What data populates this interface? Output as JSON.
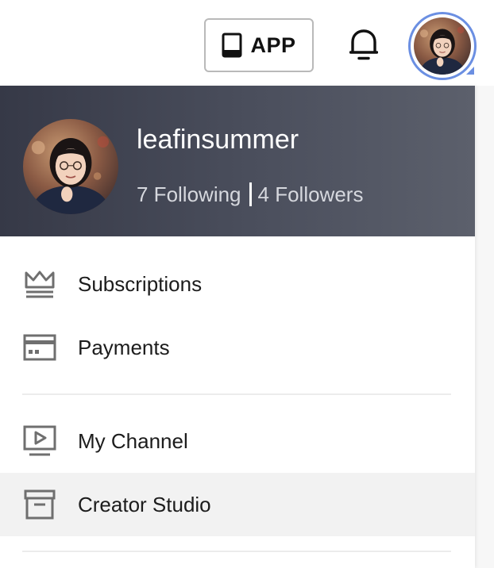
{
  "topbar": {
    "app_label": "APP",
    "app_icon": "tablet-icon",
    "notification_icon": "bell-icon",
    "avatar_icon": "user-avatar"
  },
  "profile": {
    "username": "leafinsummer",
    "following": "7 Following",
    "followers": "4 Followers"
  },
  "menu": {
    "items": [
      {
        "label": "Subscriptions",
        "icon": "crown-icon"
      },
      {
        "label": "Payments",
        "icon": "credit-card-icon"
      },
      {
        "label": "My Channel",
        "icon": "play-screen-icon"
      },
      {
        "label": "Creator Studio",
        "icon": "archive-box-icon"
      }
    ]
  },
  "colors": {
    "avatar_ring": "#6b8fe2",
    "header_dark": "#363947",
    "header_light": "#5c606c",
    "highlight_row": "#f2f2f2",
    "icon_gray": "#6f6f6f"
  }
}
